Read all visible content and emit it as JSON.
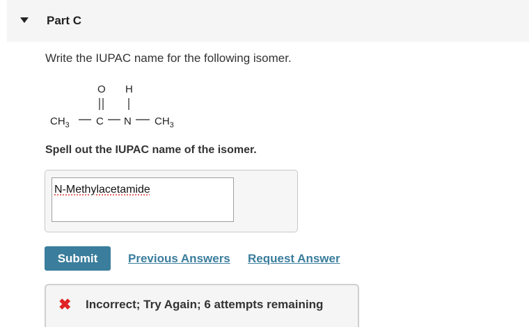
{
  "part": {
    "title": "Part C"
  },
  "question": {
    "prompt": "Write the IUPAC name for the following isomer."
  },
  "structure": {
    "left_group": "CH",
    "left_group_sub": "3",
    "carbon": "C",
    "oxygen": "O",
    "nitrogen": "N",
    "hydrogen": "H",
    "right_group": "CH",
    "right_group_sub": "3"
  },
  "instruction": "Spell out the IUPAC name of the isomer.",
  "answer": {
    "value": "N-Methylacetamide"
  },
  "actions": {
    "submit": "Submit",
    "previous_answers": "Previous Answers",
    "request_answer": "Request Answer"
  },
  "feedback": {
    "icon": "x-icon",
    "text": "Incorrect; Try Again; 6 attempts remaining",
    "color": "#e02424"
  },
  "colors": {
    "accent": "#3a7d9c",
    "header_bg": "#f5f5f5"
  }
}
